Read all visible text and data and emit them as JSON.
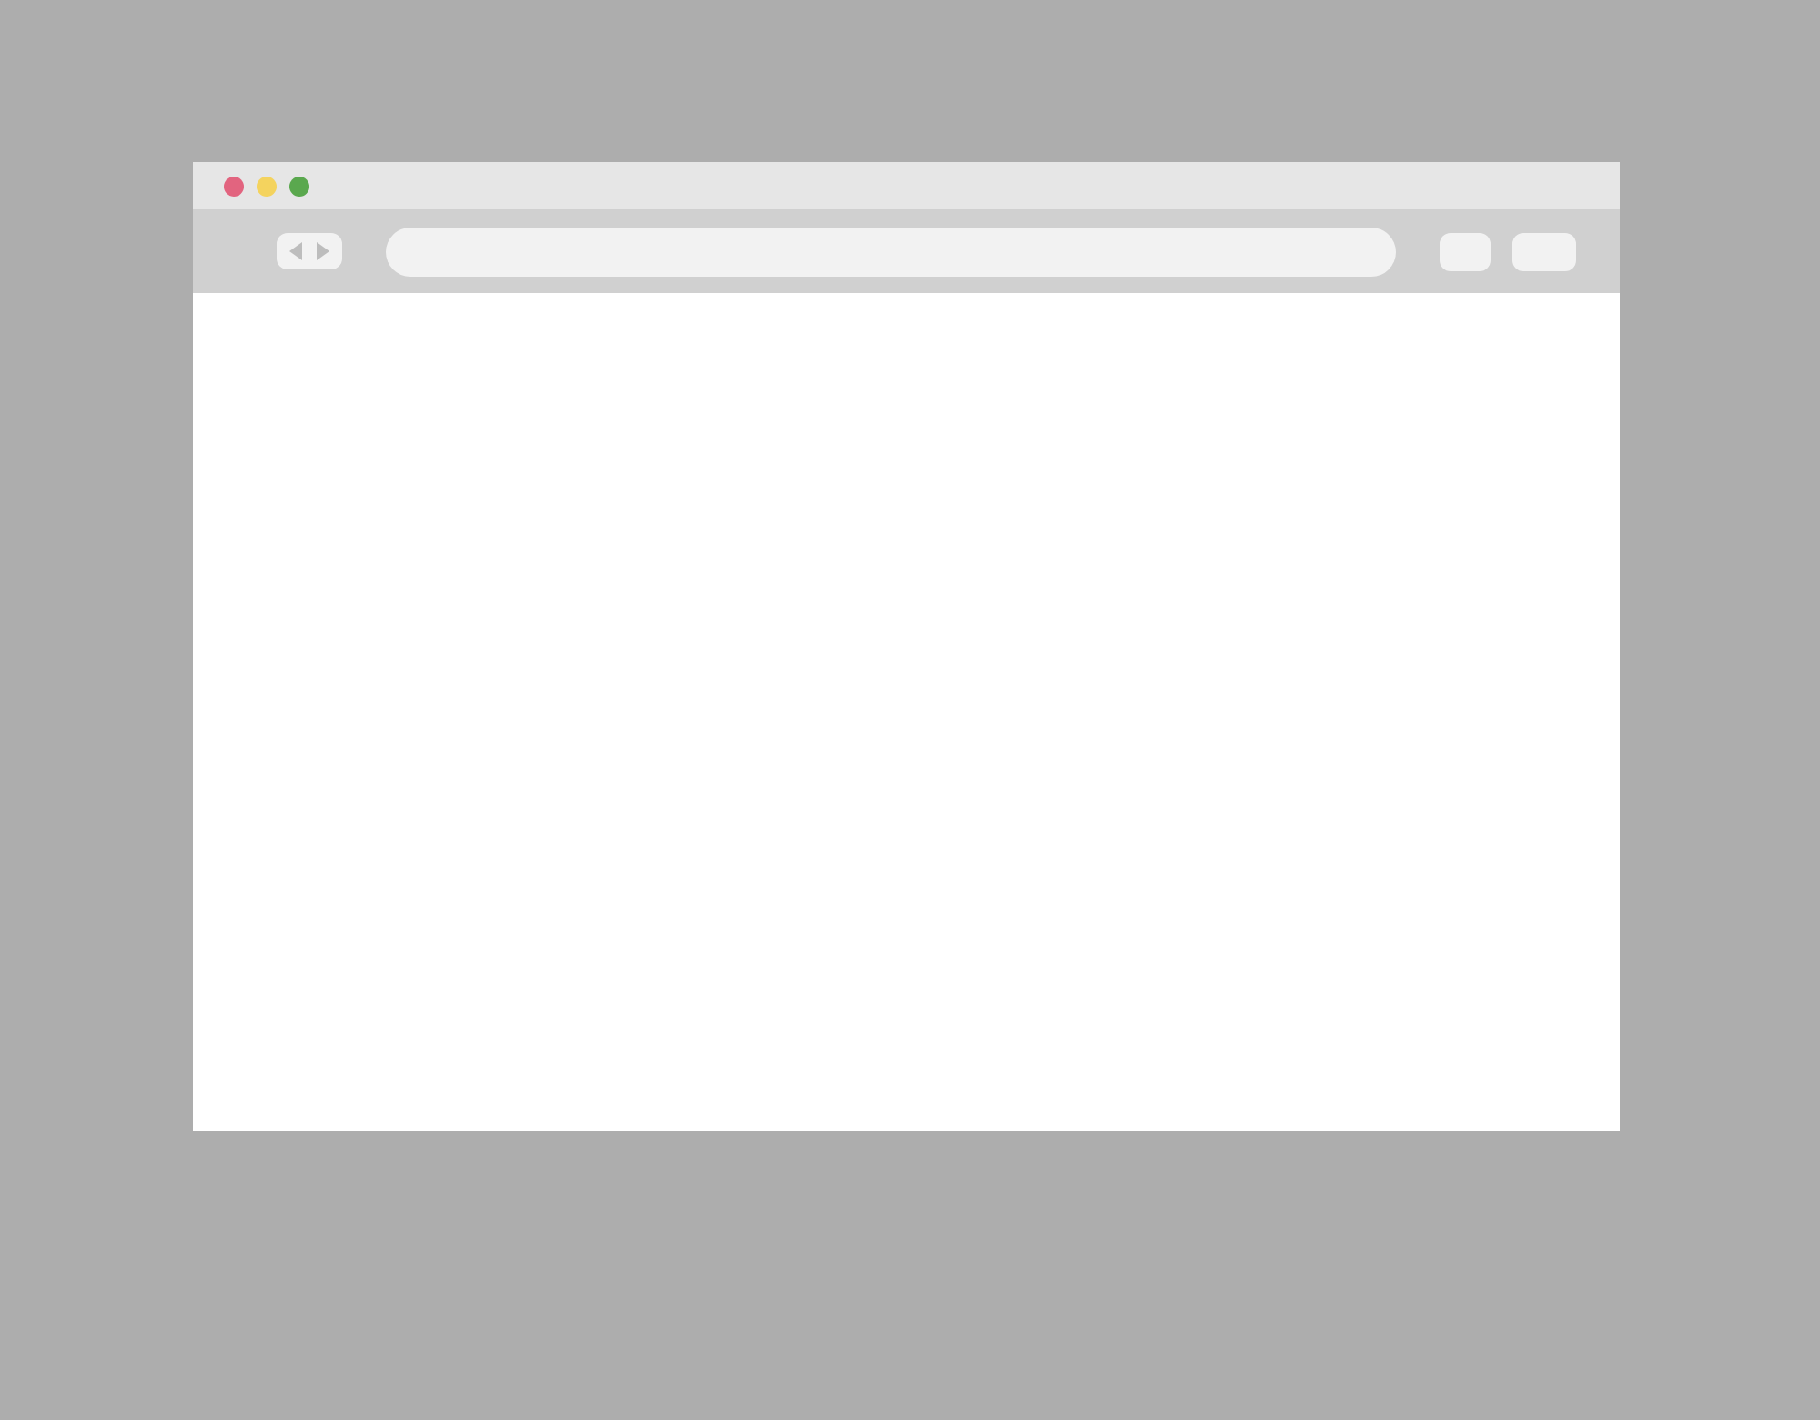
{
  "window": {
    "traffic_lights": [
      {
        "color": "#e2647f"
      },
      {
        "color": "#f4d35e"
      },
      {
        "color": "#5aa84e"
      }
    ]
  }
}
